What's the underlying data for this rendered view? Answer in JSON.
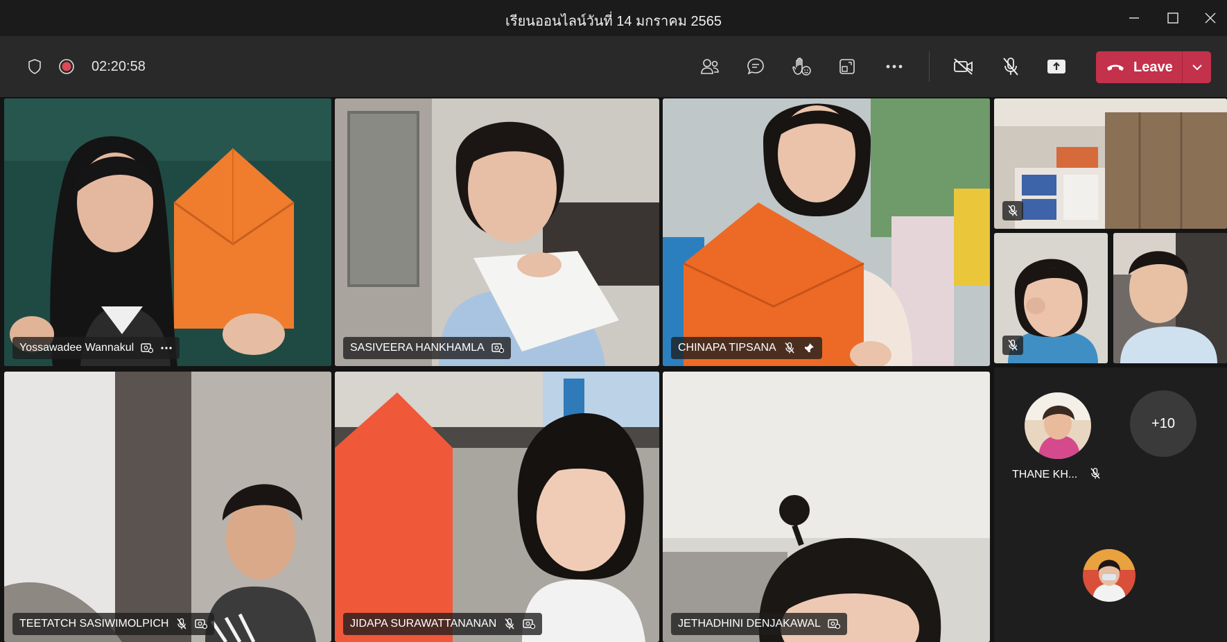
{
  "window": {
    "title": "เรียนออนไลน์วันที่ 14 มกราคม 2565"
  },
  "toolbar": {
    "timer": "02:20:58",
    "leave_label": "Leave",
    "icons": [
      "shield-icon",
      "record-icon",
      "people-icon",
      "chat-icon",
      "raise-hand-icon",
      "view-icon",
      "more-icon",
      "camera-off-icon",
      "mic-off-icon",
      "share-icon",
      "phone-icon",
      "chevron-down-icon"
    ]
  },
  "participants": [
    {
      "name": "Yossawadee Wannakul",
      "status": "video-effects, more-options",
      "active": true
    },
    {
      "name": "SASIVEERA HANKHAMLA",
      "status": "video-effects",
      "active": true
    },
    {
      "name": "CHINAPA TIPSANA",
      "status": "muted, pinned",
      "active": false
    },
    {
      "name": "TEETATCH SASIWIMOLPICH",
      "status": "muted, video-effects",
      "active": false
    },
    {
      "name": "JIDAPA SURAWATTANANAN",
      "status": "muted, video-effects",
      "active": false
    },
    {
      "name": "JETHADHINI DENJAKAWAL",
      "status": "video-effects",
      "active": false
    }
  ],
  "side_panel": {
    "avatar_name": "THANE KH...",
    "overflow_count": "+10"
  },
  "colors": {
    "accent_purple": "#9a9cf0",
    "leave_red": "#c4314b",
    "bar": "#292929"
  }
}
